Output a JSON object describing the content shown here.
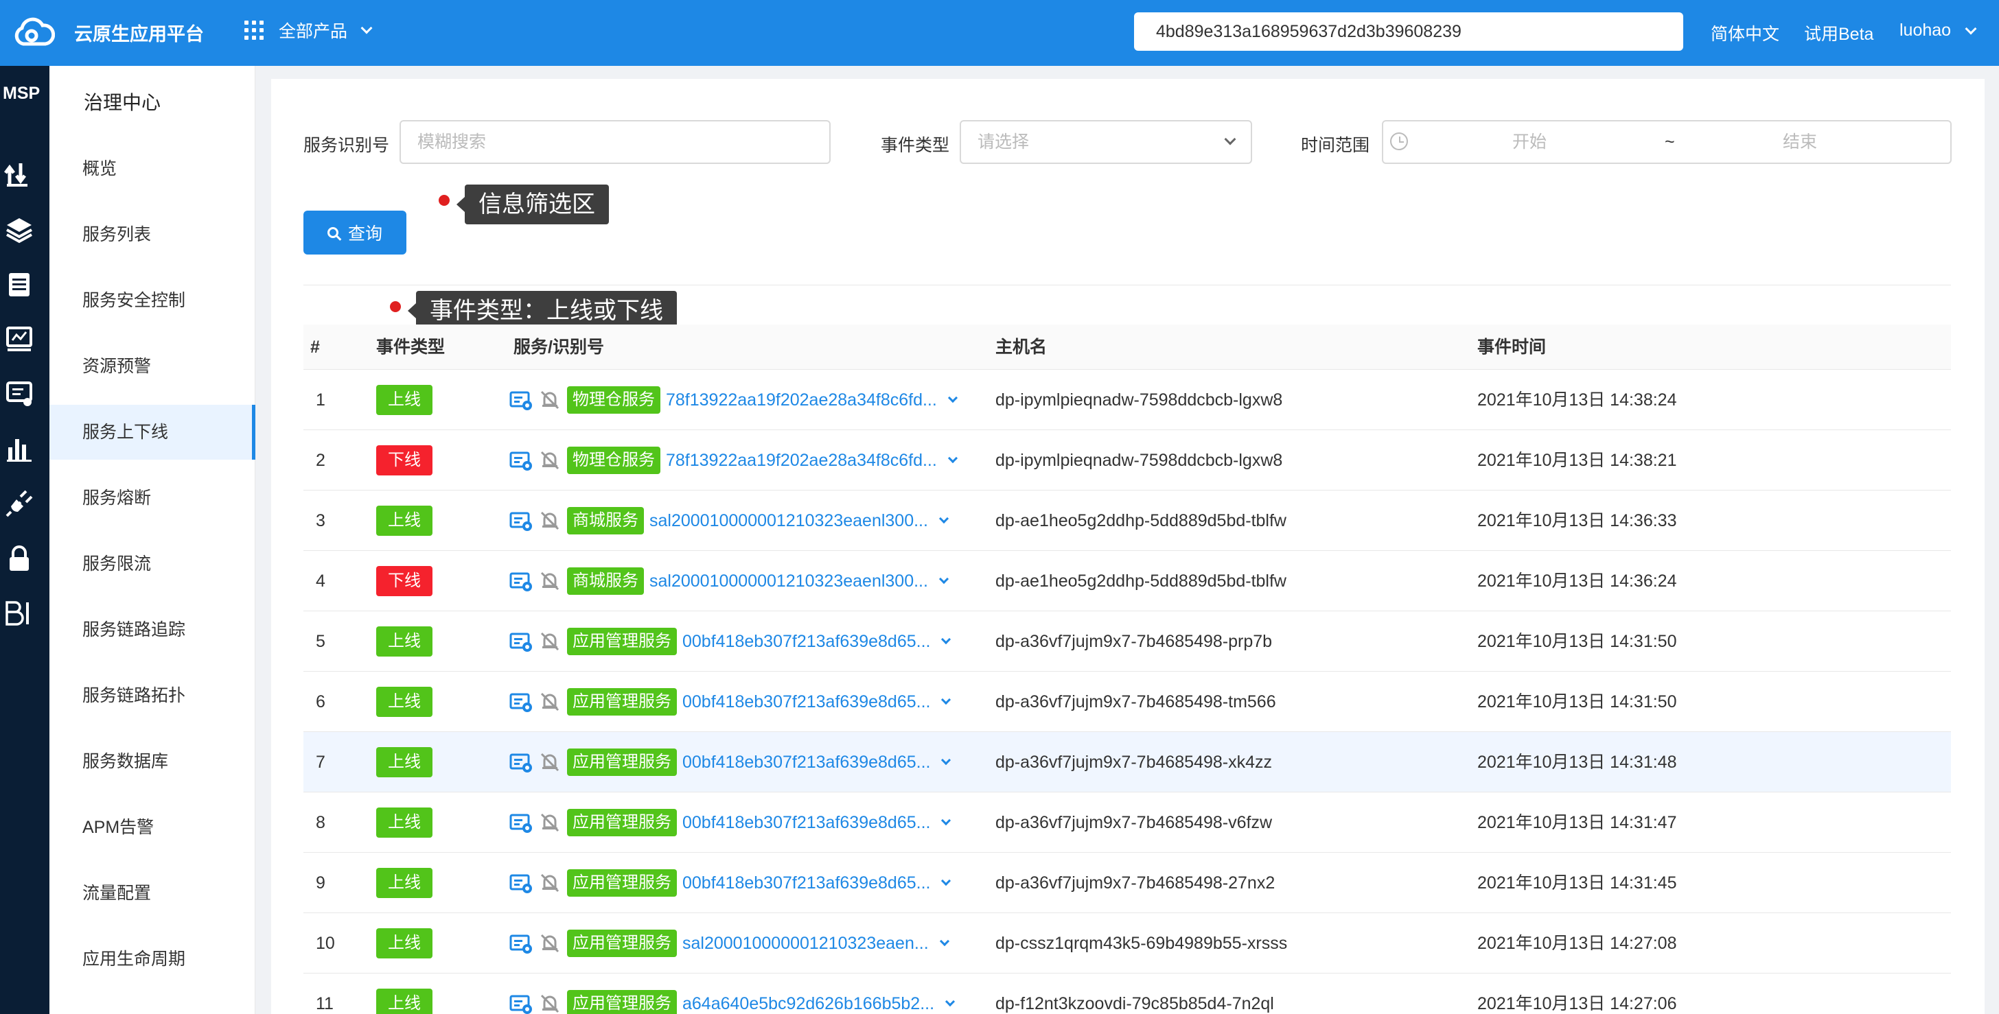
{
  "header": {
    "brand": "云原生应用平台",
    "products_label": "全部产品",
    "search_value": "4bd89e313a168959637d2d3b39608239",
    "language": "简体中文",
    "beta": "试用Beta",
    "user": "luohao"
  },
  "iconbar": {
    "msp": "MSP",
    "icons": [
      "transfer-icon",
      "layers-icon",
      "clipboard-icon",
      "monitor-icon",
      "message-icon",
      "bar-chart-icon",
      "plug-icon",
      "lock-icon",
      "bi-icon"
    ]
  },
  "menu": {
    "title": "治理中心",
    "items": [
      {
        "label": "概览"
      },
      {
        "label": "服务列表"
      },
      {
        "label": "服务安全控制"
      },
      {
        "label": "资源预警"
      },
      {
        "label": "服务上下线",
        "active": true
      },
      {
        "label": "服务熔断"
      },
      {
        "label": "服务限流"
      },
      {
        "label": "服务链路追踪"
      },
      {
        "label": "服务链路拓扑"
      },
      {
        "label": "服务数据库"
      },
      {
        "label": "APM告警"
      },
      {
        "label": "流量配置"
      },
      {
        "label": "应用生命周期"
      }
    ]
  },
  "filters": {
    "service_id_label": "服务识别号",
    "service_id_placeholder": "模糊搜索",
    "event_type_label": "事件类型",
    "event_type_placeholder": "请选择",
    "time_range_label": "时间范围",
    "time_start": "开始",
    "time_sep": "~",
    "time_end": "结束",
    "query_button": "查询"
  },
  "tooltips": {
    "filter_area": "信息筛选区",
    "event_type": "事件类型：上线或下线"
  },
  "table": {
    "headers": [
      "#",
      "事件类型",
      "服务/识别号",
      "主机名",
      "事件时间"
    ],
    "rows": [
      {
        "n": "1",
        "status": "上线",
        "type": "on",
        "tag": "物理仓服务",
        "id": "78f13922aa19f202ae28a34f8c6fd...",
        "host": "dp-ipymlpieqnadw-7598ddcbcb-lgxw8",
        "time": "2021年10月13日 14:38:24"
      },
      {
        "n": "2",
        "status": "下线",
        "type": "off",
        "tag": "物理仓服务",
        "id": "78f13922aa19f202ae28a34f8c6fd...",
        "host": "dp-ipymlpieqnadw-7598ddcbcb-lgxw8",
        "time": "2021年10月13日 14:38:21"
      },
      {
        "n": "3",
        "status": "上线",
        "type": "on",
        "tag": "商城服务",
        "id": "sal200010000001210323eaenl300...",
        "host": "dp-ae1heo5g2ddhp-5dd889d5bd-tblfw",
        "time": "2021年10月13日 14:36:33"
      },
      {
        "n": "4",
        "status": "下线",
        "type": "off",
        "tag": "商城服务",
        "id": "sal200010000001210323eaenl300...",
        "host": "dp-ae1heo5g2ddhp-5dd889d5bd-tblfw",
        "time": "2021年10月13日 14:36:24"
      },
      {
        "n": "5",
        "status": "上线",
        "type": "on",
        "tag": "应用管理服务",
        "id": "00bf418eb307f213af639e8d65...",
        "host": "dp-a36vf7jujm9x7-7b4685498-prp7b",
        "time": "2021年10月13日 14:31:50"
      },
      {
        "n": "6",
        "status": "上线",
        "type": "on",
        "tag": "应用管理服务",
        "id": "00bf418eb307f213af639e8d65...",
        "host": "dp-a36vf7jujm9x7-7b4685498-tm566",
        "time": "2021年10月13日 14:31:50"
      },
      {
        "n": "7",
        "status": "上线",
        "type": "on",
        "tag": "应用管理服务",
        "id": "00bf418eb307f213af639e8d65...",
        "host": "dp-a36vf7jujm9x7-7b4685498-xk4zz",
        "time": "2021年10月13日 14:31:48",
        "highlight": true
      },
      {
        "n": "8",
        "status": "上线",
        "type": "on",
        "tag": "应用管理服务",
        "id": "00bf418eb307f213af639e8d65...",
        "host": "dp-a36vf7jujm9x7-7b4685498-v6fzw",
        "time": "2021年10月13日 14:31:47"
      },
      {
        "n": "9",
        "status": "上线",
        "type": "on",
        "tag": "应用管理服务",
        "id": "00bf418eb307f213af639e8d65...",
        "host": "dp-a36vf7jujm9x7-7b4685498-27nx2",
        "time": "2021年10月13日 14:31:45"
      },
      {
        "n": "10",
        "status": "上线",
        "type": "on",
        "tag": "应用管理服务",
        "id": "sal200010000001210323eaen...",
        "host": "dp-cssz1qrqm43k5-69b4989b55-xrsss",
        "time": "2021年10月13日 14:27:08"
      },
      {
        "n": "11",
        "status": "上线",
        "type": "on",
        "tag": "应用管理服务",
        "id": "a64a640e5bc92d626b166b5b2...",
        "host": "dp-f12nt3kzoovdi-79c85b85d4-7n2ql",
        "time": "2021年10月13日 14:27:06"
      }
    ]
  },
  "colors": {
    "header_bg": "#1e88e5",
    "iconbar_bg": "#0a1e35",
    "online": "#52c41a",
    "offline": "#f5222d",
    "link": "#1e88e5"
  }
}
